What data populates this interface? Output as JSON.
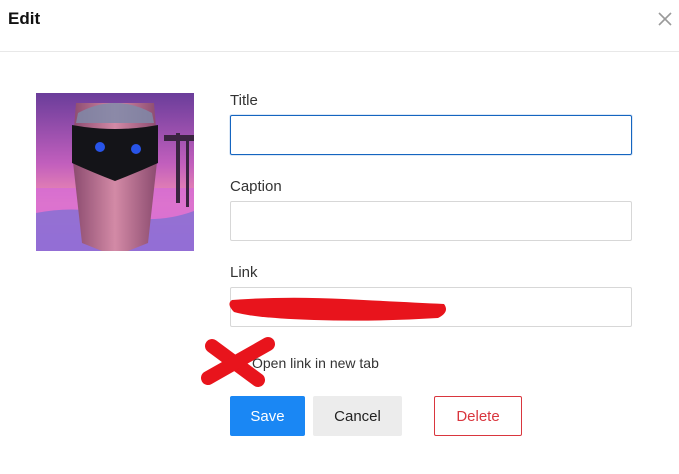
{
  "dialog": {
    "title": "Edit",
    "close_icon": "close-icon"
  },
  "thumbnail": {
    "kind": "image-thumbnail"
  },
  "form": {
    "title_label": "Title",
    "title_value": "",
    "caption_label": "Caption",
    "caption_value": "",
    "link_label": "Link",
    "link_value": "",
    "open_new_tab_label": "Open link in new tab",
    "open_new_tab_checked": false
  },
  "buttons": {
    "save_label": "Save",
    "cancel_label": "Cancel",
    "delete_label": "Delete"
  },
  "colors": {
    "primary": "#1a87f4",
    "danger": "#d9363e",
    "focus_border": "#1565c0",
    "redaction": "#e8141c"
  }
}
